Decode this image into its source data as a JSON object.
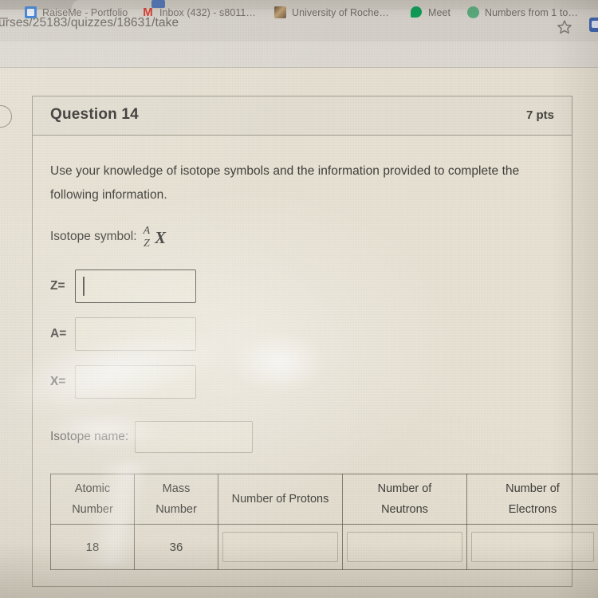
{
  "browser": {
    "url": "urses/25183/quizzes/18631/take",
    "star_icon": "star-icon",
    "extension_icon": "extension-icon",
    "bookmarks": [
      {
        "label": "RaiseMe - Portfolio",
        "icon": "raiseme-favicon"
      },
      {
        "label": "Inbox (432) - s8011…",
        "icon": "gmail-favicon",
        "glyph": "M"
      },
      {
        "label": "University of Roche…",
        "icon": "university-favicon"
      },
      {
        "label": "Meet",
        "icon": "google-meet-favicon"
      },
      {
        "label": "Numbers from 1 to…",
        "icon": "numbers-favicon"
      }
    ]
  },
  "quiz": {
    "header": {
      "question_title": "Question 14",
      "points": "7 pts"
    },
    "prompt": "Use your knowledge of isotope symbols and the information provided to complete the following information.",
    "isotope_symbol": {
      "label": "Isotope symbol:",
      "mass_number_superscript": "A",
      "atomic_number_subscript": "Z",
      "element": "X"
    },
    "fields": [
      {
        "label": "Z=",
        "value": "",
        "focused": true
      },
      {
        "label": "A=",
        "value": "",
        "focused": false
      },
      {
        "label": "X=",
        "value": "",
        "focused": false
      }
    ],
    "isotope_name": {
      "label": "Isotope name:",
      "value": ""
    },
    "table": {
      "headers": [
        "Atomic Number",
        "Mass Number",
        "Number of Protons",
        "Number of Neutrons",
        "Number of Electrons"
      ],
      "header_lines": [
        [
          "Atomic",
          "Number"
        ],
        [
          "Mass",
          "Number"
        ],
        [
          "Number of Protons"
        ],
        [
          "Number of",
          "Neutrons"
        ],
        [
          "Number of",
          "Electrons"
        ]
      ],
      "row": {
        "atomic_number": "18",
        "mass_number": "36",
        "number_of_protons": "",
        "number_of_neutrons": "",
        "number_of_electrons": ""
      }
    }
  },
  "colors": {
    "page_background": "#e7e1d3",
    "card_background": "#e9e3d5",
    "card_border": "#6e6656",
    "text_primary": "#3f3e3a",
    "browser_chrome": "#d5d1ca",
    "bookmark_bar": "#dedad3",
    "gmail_red": "#d93025",
    "meet_green": "#0f9d58",
    "raiseme_blue": "#3a7fd5"
  }
}
